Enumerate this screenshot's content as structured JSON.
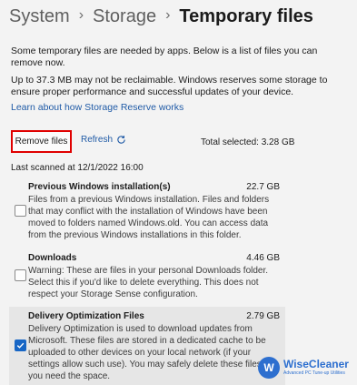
{
  "breadcrumb": {
    "items": [
      "System",
      "Storage"
    ],
    "current": "Temporary files",
    "separator": "›"
  },
  "intro": {
    "text1": "Some temporary files are needed by apps. Below is a list of files you can remove now.",
    "text2": "Up to 37.3 MB may not be reclaimable. Windows reserves some storage to ensure proper performance and successful updates of your device.",
    "link": "Learn about how Storage Reserve works"
  },
  "actions": {
    "remove_label": "Remove files",
    "refresh_label": "Refresh",
    "total_selected": "Total selected: 3.28 GB",
    "last_scanned": "Last scanned at 12/1/2022 16:00"
  },
  "items": [
    {
      "title": "Previous Windows installation(s)",
      "size": "22.7 GB",
      "checked": false,
      "description": "Files from a previous Windows installation.  Files and folders that may conflict with the installation of Windows have been moved to folders named Windows.old.  You can access data from the previous Windows installations in this folder."
    },
    {
      "title": "Downloads",
      "size": "4.46 GB",
      "checked": false,
      "description": "Warning: These are files in your personal Downloads folder. Select this if you'd like to delete everything. This does not respect your Storage Sense configuration."
    },
    {
      "title": "Delivery Optimization Files",
      "size": "2.79 GB",
      "checked": true,
      "description": "Delivery Optimization is used to download updates from Microsoft. These files are stored in a dedicated cache to be uploaded to other devices on your local network (if your settings allow such use). You may safely delete these files if you need the space."
    }
  ],
  "watermark": {
    "title": "WiseCleaner",
    "tagline": "Advanced PC Tune-up Utilities",
    "logo_letter": "W"
  },
  "colors": {
    "accent": "#1766c5",
    "link": "#1f5aa6",
    "highlight_border": "#e00000"
  }
}
